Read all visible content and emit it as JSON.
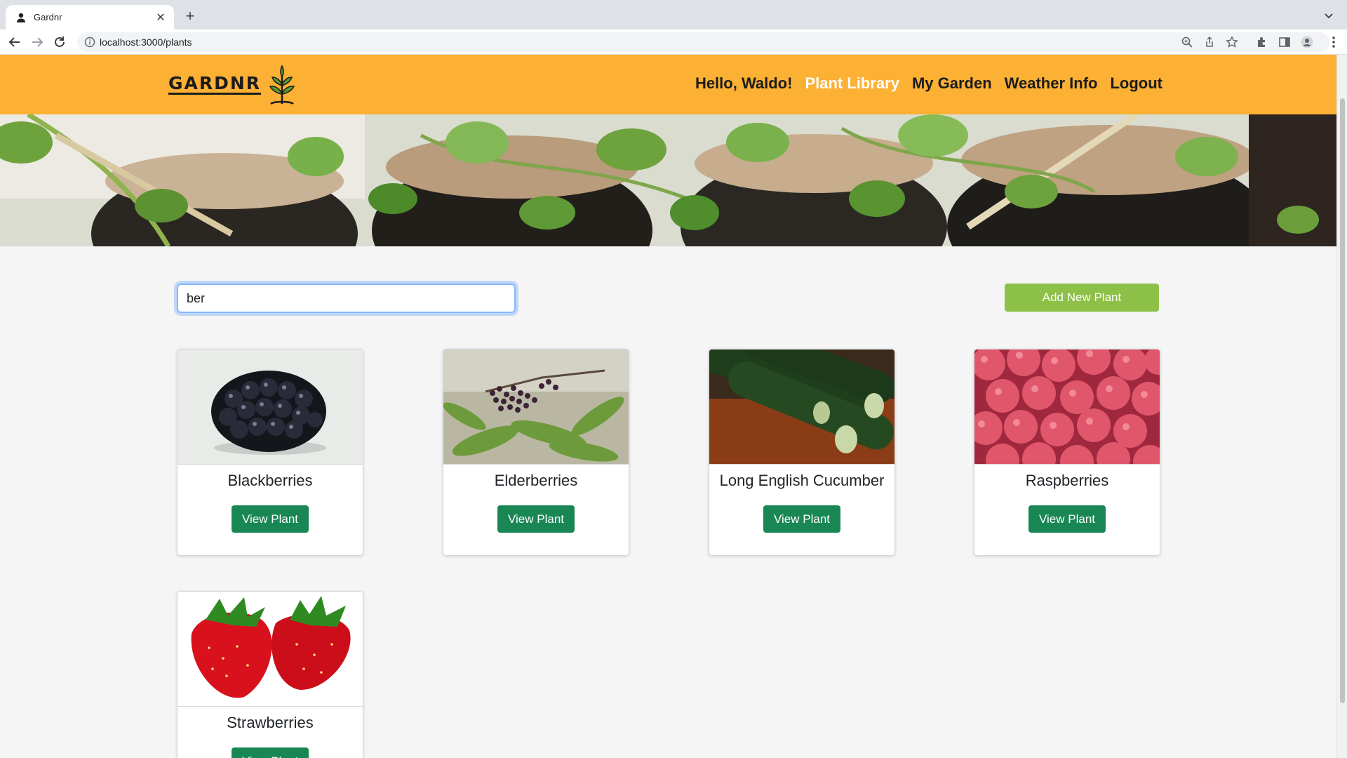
{
  "browser": {
    "tab_title": "Gardnr",
    "url": "localhost:3000/plants"
  },
  "header": {
    "logo_text": "GARDNR",
    "greeting": "Hello, Waldo!",
    "nav": [
      {
        "label": "Plant Library",
        "active": true
      },
      {
        "label": "My Garden",
        "active": false
      },
      {
        "label": "Weather Info",
        "active": false
      },
      {
        "label": "Logout",
        "active": false
      }
    ]
  },
  "search": {
    "value": "ber"
  },
  "add_button_label": "Add New Plant",
  "plants": [
    {
      "name": "Blackberries",
      "button": "View Plant",
      "image": "blackberry-image"
    },
    {
      "name": "Elderberries",
      "button": "View Plant",
      "image": "elderberry-image"
    },
    {
      "name": "Long English Cucumber",
      "button": "View Plant",
      "image": "cucumber-image"
    },
    {
      "name": "Raspberries",
      "button": "View Plant",
      "image": "raspberry-image"
    },
    {
      "name": "Strawberries",
      "button": "View Plant",
      "image": "strawberry-image"
    }
  ],
  "colors": {
    "header_bg": "#fcb034",
    "nav_active": "#ffffff",
    "add_button": "#8dc046",
    "view_button": "#198754"
  }
}
